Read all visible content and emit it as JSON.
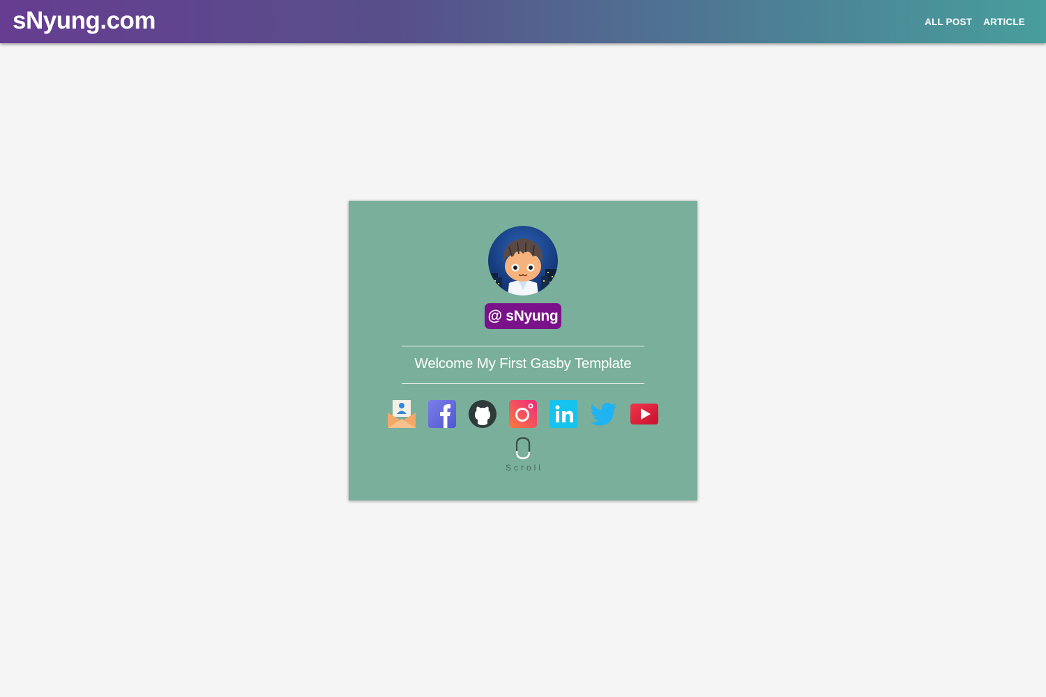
{
  "header": {
    "brand": "sNyung.com",
    "nav": [
      {
        "label": "ALL POST"
      },
      {
        "label": "ARTICLE"
      }
    ]
  },
  "profile": {
    "handle": "@ sNyung",
    "welcome": "Welcome My First Gasby Template",
    "socials": [
      {
        "icon": "email-icon"
      },
      {
        "icon": "facebook-icon"
      },
      {
        "icon": "github-icon"
      },
      {
        "icon": "instagram-icon"
      },
      {
        "icon": "linkedin-icon"
      },
      {
        "icon": "twitter-icon"
      },
      {
        "icon": "youtube-icon"
      }
    ],
    "scroll_label": "Scroll"
  },
  "colors": {
    "header_gradient_start": "#663d91",
    "header_gradient_end": "#489e9c",
    "card_background": "#79af9b",
    "handle_badge": "#7a1389",
    "page_background": "#f5f5f5"
  }
}
